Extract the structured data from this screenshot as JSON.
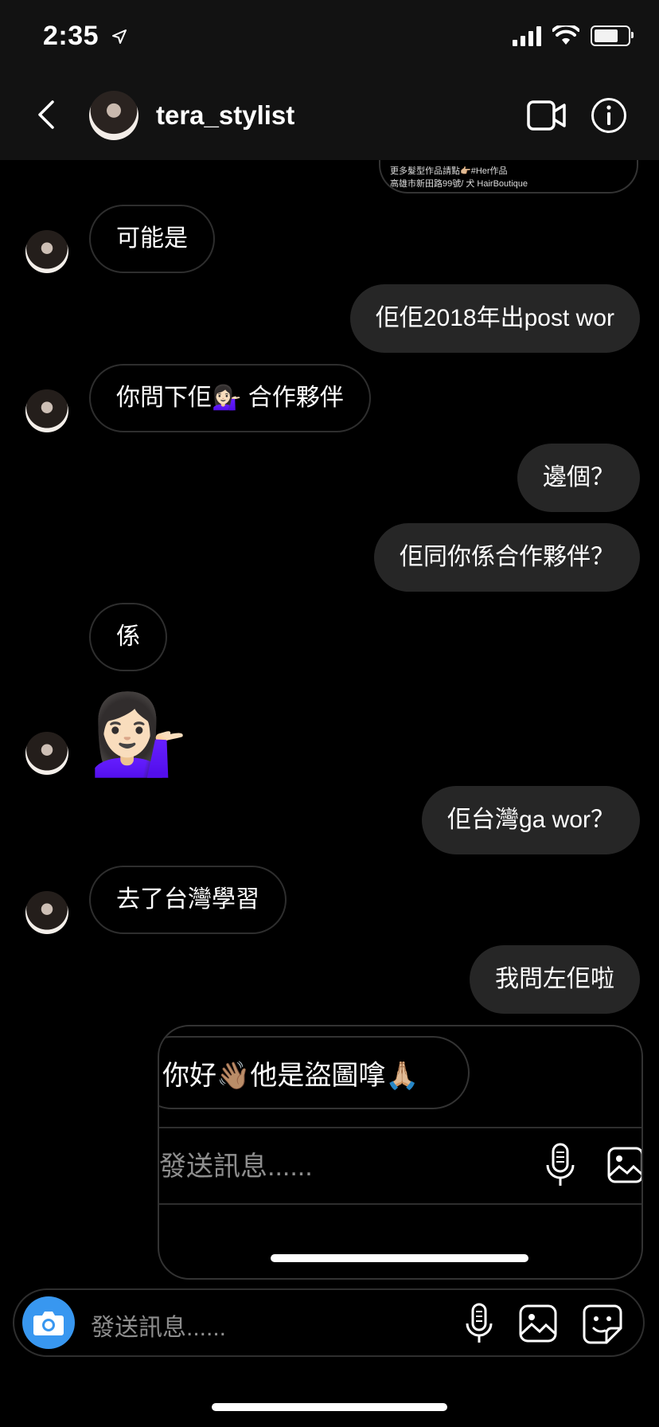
{
  "status": {
    "time": "2:35"
  },
  "header": {
    "username": "tera_stylist"
  },
  "shared_post": {
    "line1": "更多髮型作品請點👉🏼#Her作品",
    "line2": "高雄市新田路99號/ 犬 HairBoutique"
  },
  "messages": [
    {
      "side": "in",
      "text": "可能是"
    },
    {
      "side": "out",
      "text": "佢佢2018年出post wor"
    },
    {
      "side": "in",
      "text": "你問下佢💁🏻‍♀️ 合作夥伴"
    },
    {
      "side": "out",
      "text": "邊個？"
    },
    {
      "side": "out",
      "text": "佢同你係合作夥伴？"
    },
    {
      "side": "in",
      "text": "係"
    },
    {
      "side": "in",
      "text": "💁🏻‍♀️"
    },
    {
      "side": "out",
      "text": "佢台灣ga wor？"
    },
    {
      "side": "in",
      "text": "去了台灣學習"
    },
    {
      "side": "out",
      "text": "我問左佢啦"
    }
  ],
  "embedded_screenshot": {
    "message": "你好👋🏽他是盜圖嗱🙏🏼",
    "placeholder": "發送訊息......"
  },
  "composer": {
    "placeholder": "發送訊息......"
  }
}
